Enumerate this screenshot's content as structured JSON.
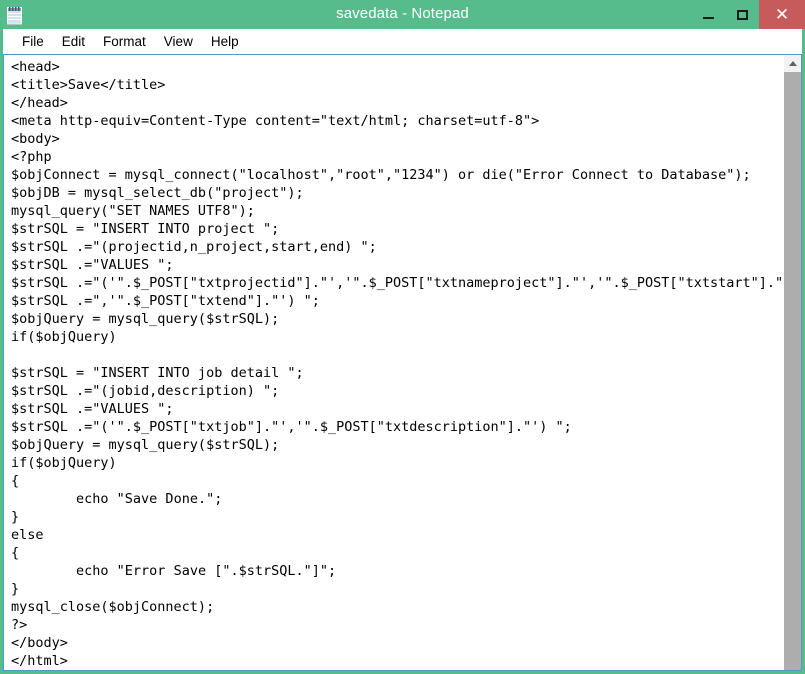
{
  "window": {
    "title": "savedata - Notepad",
    "app_icon": "notepad-icon",
    "accent_color": "#57bc8c",
    "close_button_color": "#c75b5b",
    "controls": {
      "minimize_label": "–",
      "maximize_label": "□",
      "close_label": "✕"
    }
  },
  "menubar": {
    "items": [
      {
        "label": "File"
      },
      {
        "label": "Edit"
      },
      {
        "label": "Format"
      },
      {
        "label": "View"
      },
      {
        "label": "Help"
      }
    ]
  },
  "editor": {
    "content": "<head>\n<title>Save</title>\n</head>\n<meta http-equiv=Content-Type content=\"text/html; charset=utf-8\">\n<body>\n<?php\n$objConnect = mysql_connect(\"localhost\",\"root\",\"1234\") or die(\"Error Connect to Database\");\n$objDB = mysql_select_db(\"project\");\nmysql_query(\"SET NAMES UTF8\");\n$strSQL = \"INSERT INTO project \";\n$strSQL .=\"(projectid,n_project,start,end) \";\n$strSQL .=\"VALUES \";\n$strSQL .=\"('\".$_POST[\"txtprojectid\"].\"','\".$_POST[\"txtnameproject\"].\"','\".$_POST[\"txtstart\"].\"'\n$strSQL .=\",'\".$_POST[\"txtend\"].\"') \";\n$objQuery = mysql_query($strSQL);\nif($objQuery)\n\n$strSQL = \"INSERT INTO job detail \";\n$strSQL .=\"(jobid,description) \";\n$strSQL .=\"VALUES \";\n$strSQL .=\"('\".$_POST[\"txtjob\"].\"','\".$_POST[\"txtdescription\"].\"') \";\n$objQuery = mysql_query($strSQL);\nif($objQuery)\n{\n\techo \"Save Done.\";\n}\nelse\n{\n\techo \"Error Save [\".$strSQL.\"]\";\n}\nmysql_close($objConnect);\n?>\n</body>\n</html>"
  },
  "scrollbar": {
    "up_arrow": "chevron-up-icon",
    "thumb_position": "top"
  }
}
